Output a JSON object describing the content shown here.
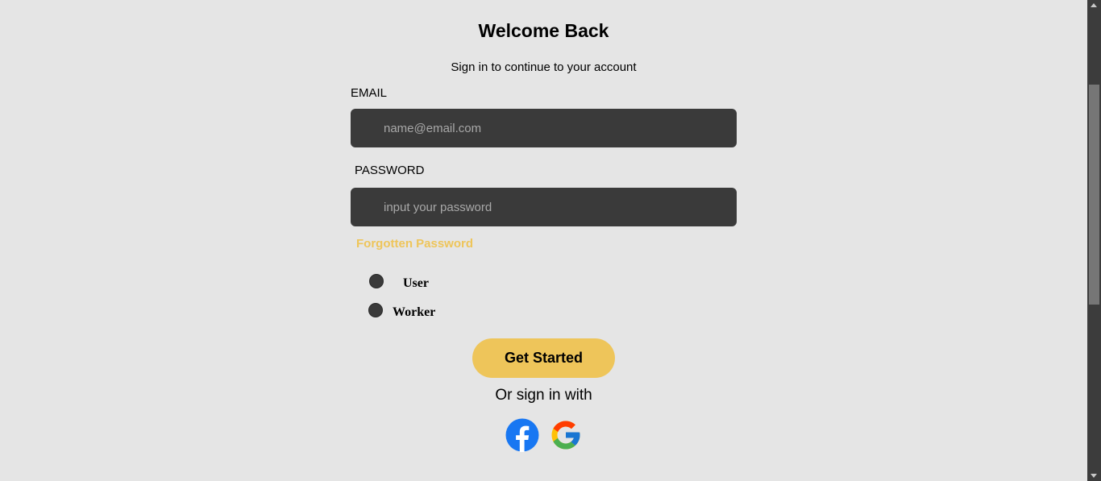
{
  "header": {
    "title": "Welcome Back",
    "subtitle": "Sign in to continue to your account"
  },
  "form": {
    "email_label": "EMAIL",
    "email_placeholder": "name@email.com",
    "email_value": "",
    "password_label": "PASSWORD",
    "password_placeholder": "input your password",
    "password_value": "",
    "forgot_label": "Forgotten Password",
    "roles": [
      {
        "label": "User",
        "selected": false
      },
      {
        "label": "Worker",
        "selected": false
      }
    ],
    "submit_label": "Get Started"
  },
  "social": {
    "prompt": "Or sign in with",
    "providers": [
      {
        "name": "facebook",
        "icon": "facebook-icon"
      },
      {
        "name": "google",
        "icon": "google-icon"
      }
    ]
  },
  "colors": {
    "background": "#e5e5e5",
    "input_bg": "#3a3a3a",
    "accent": "#eec55a",
    "facebook_blue": "#1877f2"
  }
}
